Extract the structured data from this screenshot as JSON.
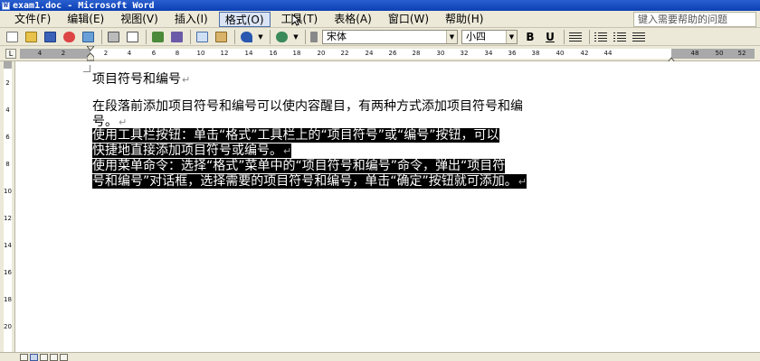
{
  "window": {
    "title": "exam1.doc - Microsoft Word"
  },
  "menubar": {
    "items": [
      "文件(F)",
      "编辑(E)",
      "视图(V)",
      "插入(I)",
      "格式(O)",
      "工具(T)",
      "表格(A)",
      "窗口(W)",
      "帮助(H)"
    ],
    "active_index": 4,
    "help_placeholder": "键入需要帮助的问题"
  },
  "toolbar": {
    "font_name": "宋体",
    "font_size": "小四",
    "bold_label": "B",
    "underline_label": "U"
  },
  "ruler": {
    "corner_label": "L",
    "ticks": [
      "4",
      "2",
      "2",
      "4",
      "6",
      "8",
      "10",
      "12",
      "14",
      "16",
      "18",
      "20",
      "22",
      "24",
      "26",
      "28",
      "30",
      "32",
      "34",
      "36",
      "38",
      "40",
      "42",
      "44",
      "48",
      "50",
      "52"
    ]
  },
  "vruler": {
    "ticks": [
      "2",
      "4",
      "6",
      "8",
      "10",
      "12",
      "14",
      "16",
      "18",
      "20"
    ]
  },
  "document": {
    "heading": "项目符号和编号",
    "para1_line1": "在段落前添加项目符号和编号可以使内容醒目，有两种方式添加项目符号和编",
    "para1_line2": "号。",
    "para2_line1": "使用工具栏按钮：单击“格式”工具栏上的“项目符号”或“编号”按钮，可以",
    "para2_line2": "快捷地直接添加项目符号或编号。",
    "para3_line1": "使用菜单命令：选择“格式”菜单中的“项目符号和编号”命令，弹出“项目符",
    "para3_line2": "号和编号”对话框，选择需要的项目符号和编号，单击“确定”按钮就可添加。",
    "paragraph_mark": "↵"
  },
  "colors": {
    "titlebar": "#0b3fb3",
    "chrome": "#ece9d8",
    "selection": "#000000"
  }
}
